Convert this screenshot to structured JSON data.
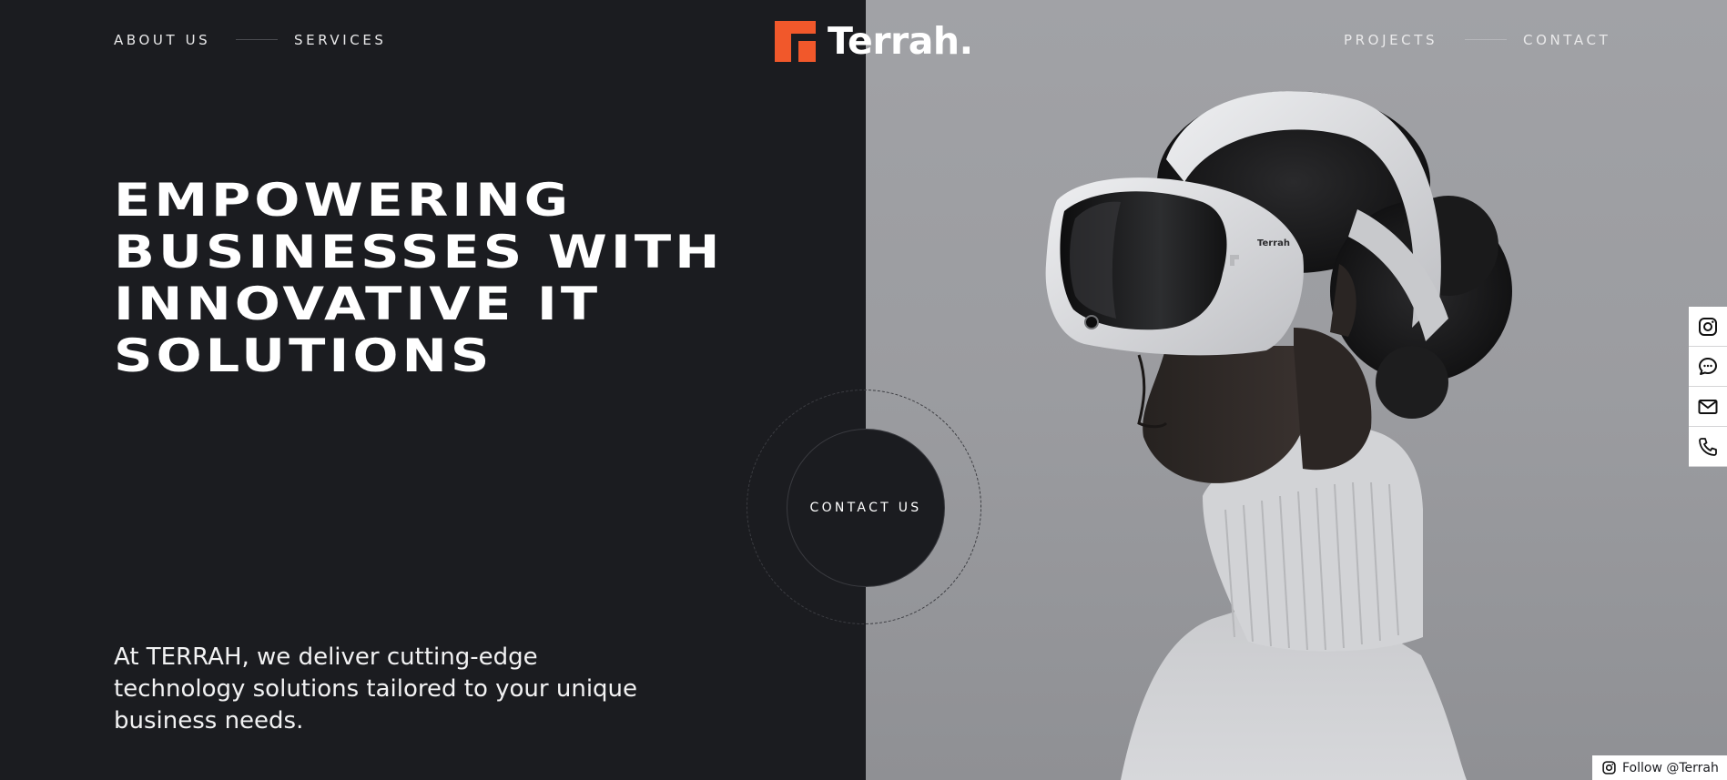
{
  "brand": {
    "name": "Terrah.",
    "accent": "#f1582b"
  },
  "nav": {
    "left": [
      {
        "label": "ABOUT US"
      },
      {
        "label": "SERVICES"
      }
    ],
    "right": [
      {
        "label": "PROJECTS"
      },
      {
        "label": "CONTACT"
      }
    ]
  },
  "hero": {
    "headline_lines": [
      "EMPOWERING",
      "BUSINESSES WITH",
      "INNOVATIVE IT",
      "SOLUTIONS"
    ],
    "intro": "At TERRAH, we deliver cutting-edge technology solutions tailored to your unique business needs.",
    "cta_label": "CONTACT US",
    "headset_label": "Terrah"
  },
  "social": {
    "icons": [
      "instagram-icon",
      "chat-icon",
      "mail-icon",
      "phone-icon"
    ],
    "follow_label": "Follow @Terrah"
  },
  "colors": {
    "dark_bg": "#1b1c20",
    "image_bg": "#9c9da1",
    "accent": "#f1582b"
  }
}
